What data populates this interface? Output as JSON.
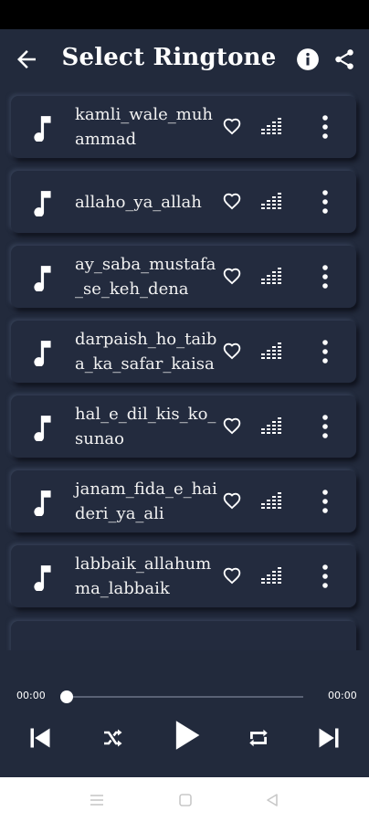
{
  "header": {
    "title": "Select Ringtone"
  },
  "icons": {
    "back": "arrow-left",
    "info": "info-circle",
    "share": "share",
    "music": "music-note",
    "favorite": "heart-outline",
    "equalizer": "equalizer",
    "more": "more-vertical"
  },
  "ringtones": [
    {
      "name": "kamli_wale_muhammad"
    },
    {
      "name": "allaho_ya_allah"
    },
    {
      "name": "ay_saba_mustafa_se_keh_dena"
    },
    {
      "name": "darpaish_ho_taiba_ka_safar_kaisa"
    },
    {
      "name": "hal_e_dil_kis_ko_sunao"
    },
    {
      "name": "janam_fida_e_haideri_ya_ali"
    },
    {
      "name": "labbaik_allahumma_labbaik"
    }
  ],
  "player": {
    "current_time": "00:00",
    "total_time": "00:00",
    "progress": 0
  },
  "colors": {
    "background": "#222a3c",
    "card": "#232b3e",
    "accent": "#ffffff"
  }
}
